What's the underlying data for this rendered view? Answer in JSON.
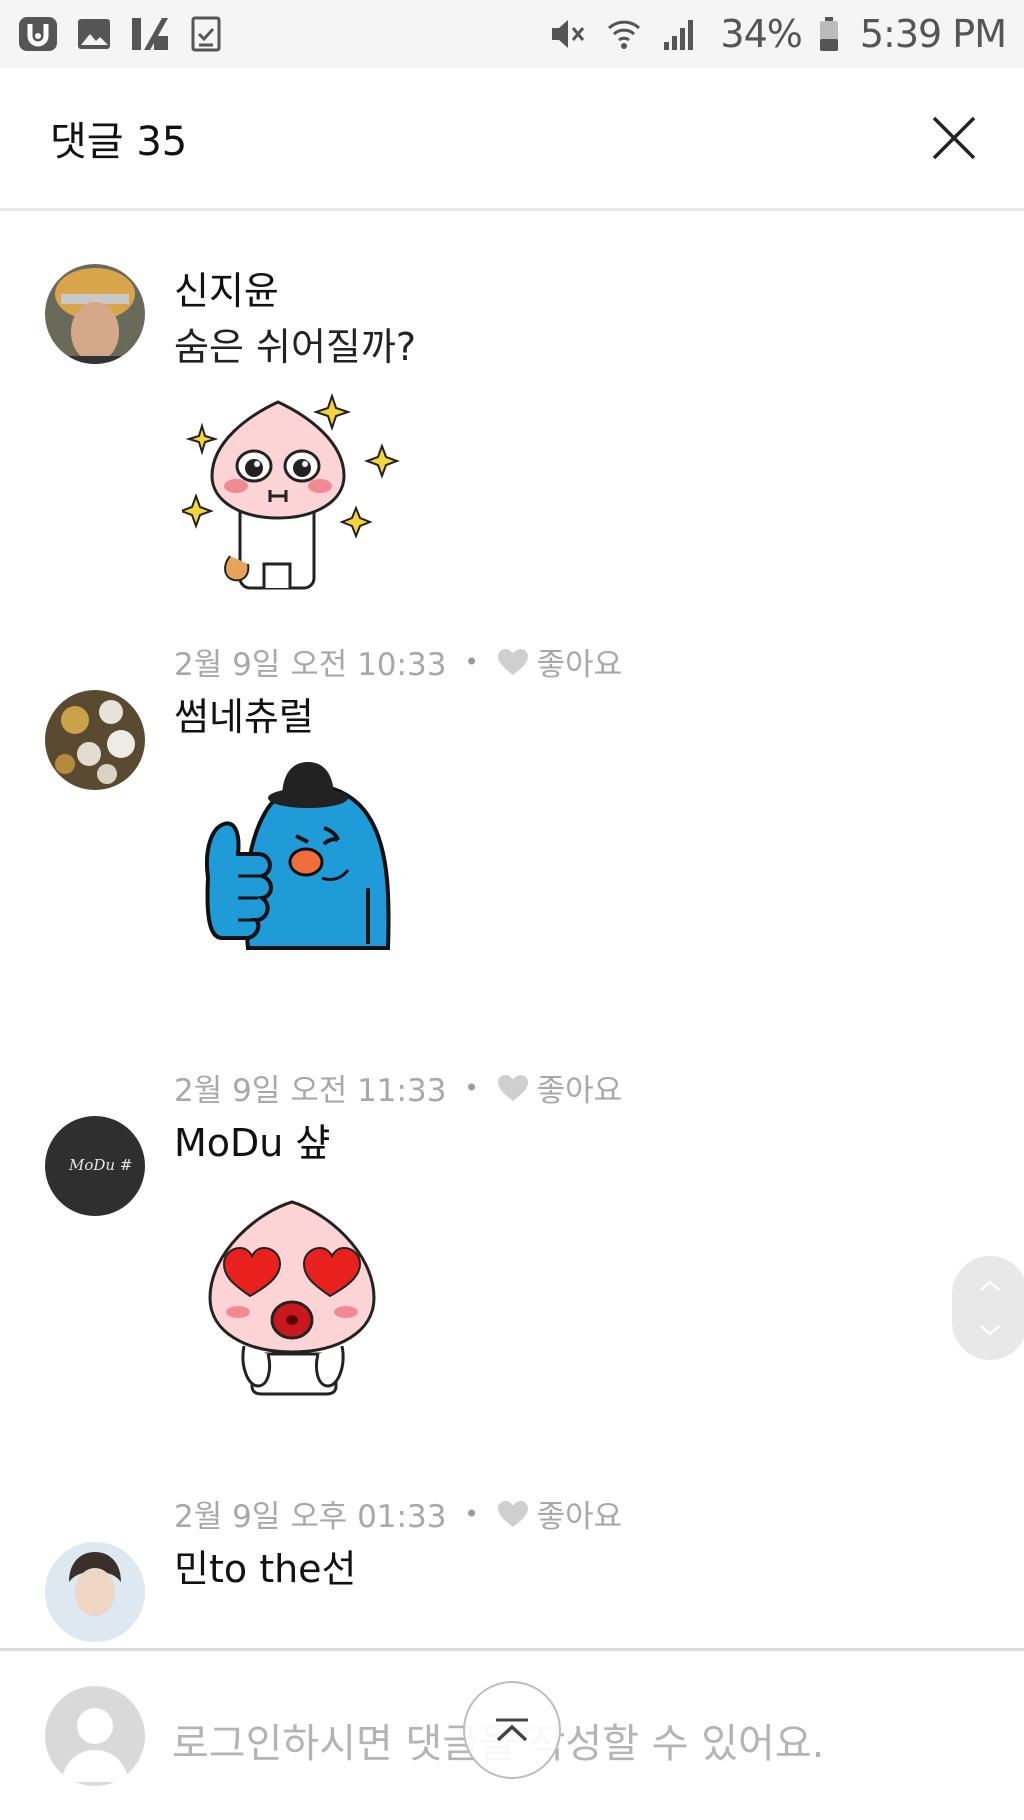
{
  "status_bar": {
    "battery": "34%",
    "time": "5:39 PM",
    "icons_left": [
      "uplus-icon",
      "image-icon",
      "app-icon",
      "checkbox-icon"
    ],
    "icons_right": [
      "mute-icon",
      "wifi-icon",
      "signal-icon",
      "battery-icon"
    ]
  },
  "header": {
    "title": "댓글 35"
  },
  "comments": [
    {
      "author": "신지윤",
      "text": "숨은 쉬어질까?",
      "sticker": "peach-sparkle-sticker",
      "time": "2월 9일 오전 10:33",
      "like_label": "좋아요"
    },
    {
      "author": "썸네츄럴",
      "text": "",
      "sticker": "blue-thumbs-up-sticker",
      "time": "2월 9일 오전 11:33",
      "like_label": "좋아요"
    },
    {
      "author": "MoDu 샾",
      "text": "",
      "avatar_text": "MoDu #",
      "sticker": "peach-heart-eyes-sticker",
      "time": "2월 9일 오후 01:33",
      "like_label": "좋아요"
    },
    {
      "author": "민to the선",
      "text": "",
      "time": "",
      "like_label": ""
    }
  ],
  "meta_separator": "•",
  "bottom_bar": {
    "placeholder": "로그인하시면 댓글을 작성할 수 있어요."
  },
  "colors": {
    "meta_text": "#a8a8a8",
    "header_border": "#e6e6e6",
    "status_bar_bg": "#f5f5f5"
  }
}
